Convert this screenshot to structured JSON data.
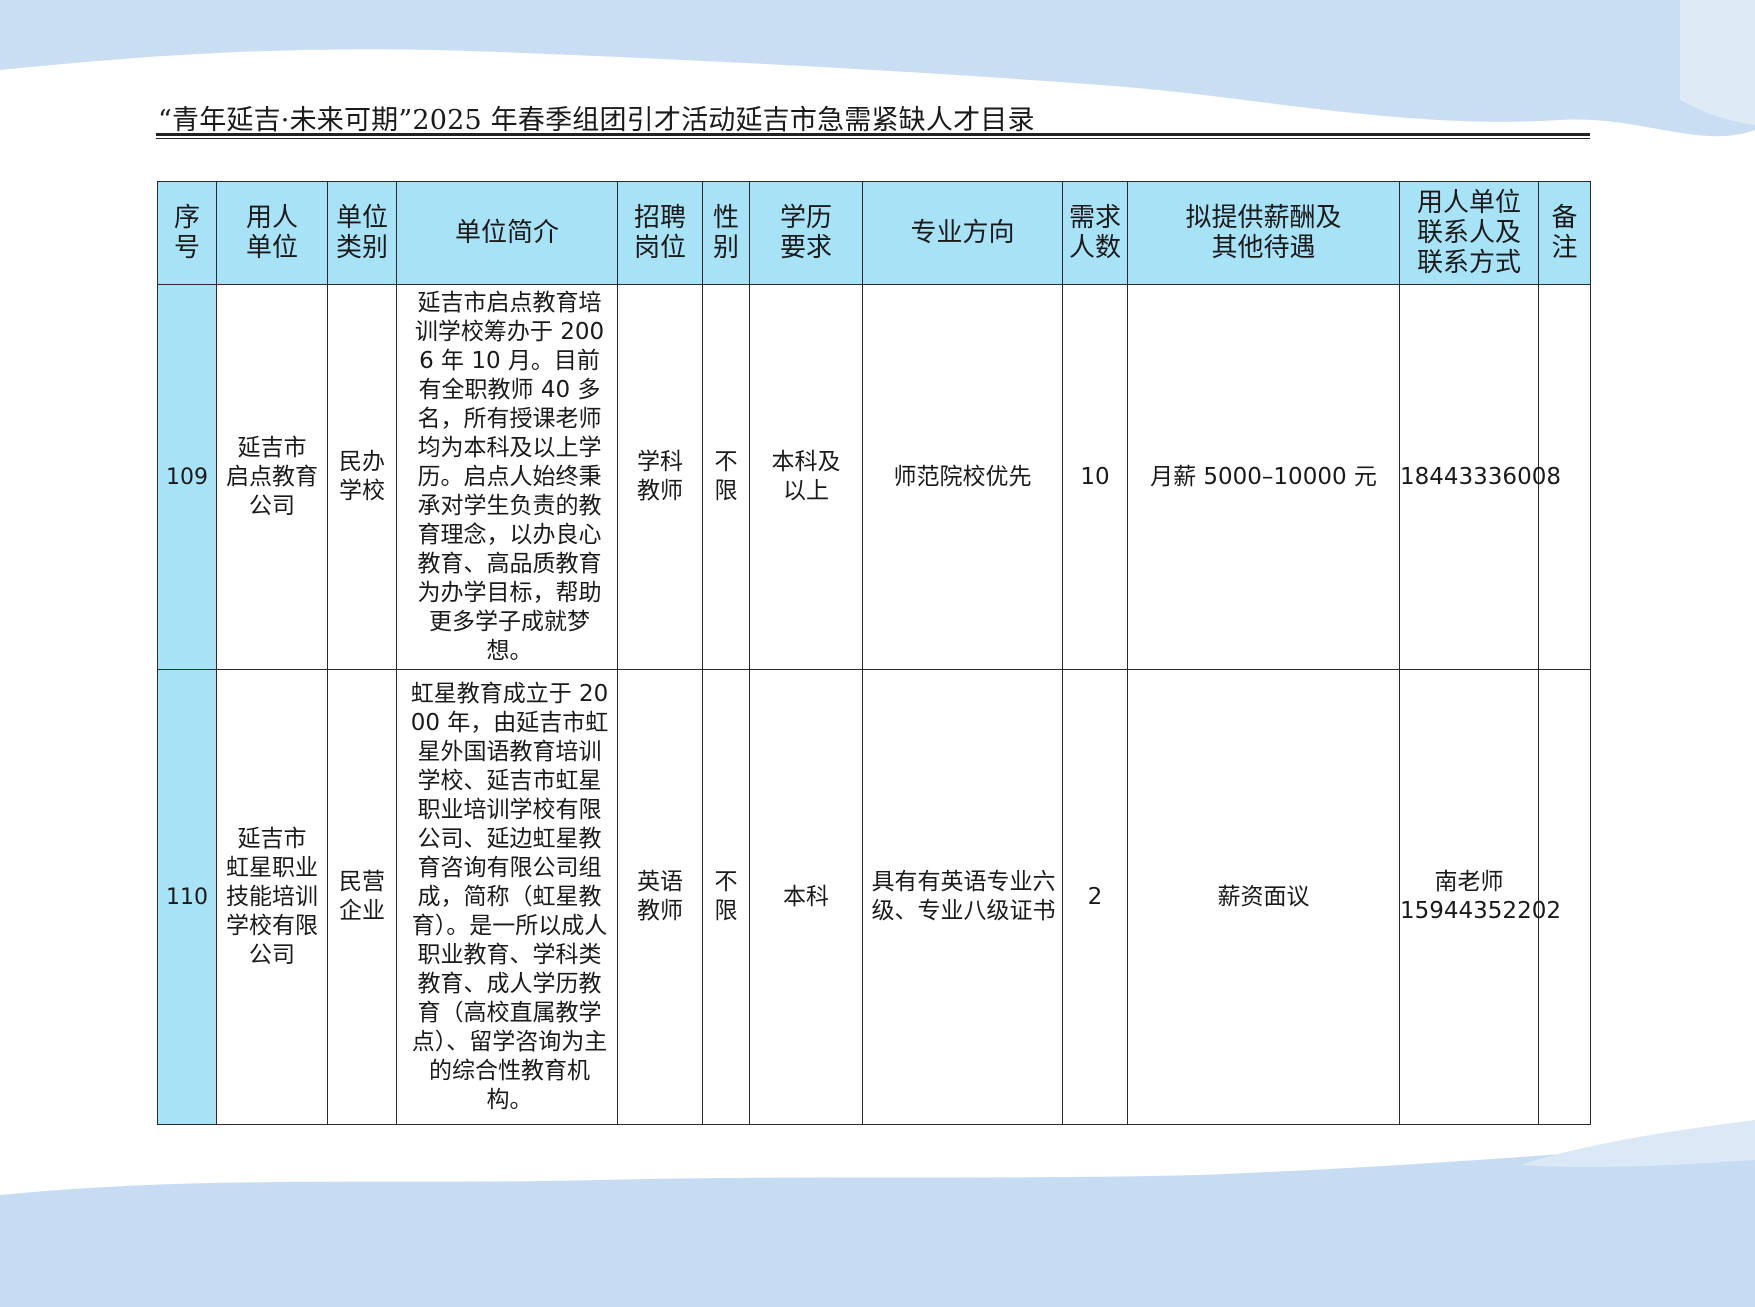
{
  "title": "“青年延吉·未来可期”2025 年春季组团引才活动延吉市急需紧缺人才目录",
  "columns": [
    [
      "序",
      "号"
    ],
    [
      "用人",
      "单位"
    ],
    [
      "单位",
      "类别"
    ],
    [
      "单位简介"
    ],
    [
      "招聘",
      "岗位"
    ],
    [
      "性",
      "别"
    ],
    [
      "学历",
      "要求"
    ],
    [
      "专业方向"
    ],
    [
      "需求",
      "人数"
    ],
    [
      "拟提供薪酬及",
      "其他待遇"
    ],
    [
      "用人单位",
      "联系人及",
      "联系方式"
    ],
    [
      "备",
      "注"
    ]
  ],
  "rows": [
    {
      "index": "109",
      "employer": [
        "延吉市",
        "启点教育",
        "公司"
      ],
      "type": [
        "民办",
        "学校"
      ],
      "intro": "延吉市启点教育培训学校筹办于 2006 年 10 月。目前有全职教师 40 多名，所有授课老师均为本科及以上学历。启点人始终秉承对学生负责的教育理念，以办良心教育、高品质教育为办学目标，帮助更多学子成就梦想。",
      "position": [
        "学科",
        "教师"
      ],
      "gender": [
        "不",
        "限"
      ],
      "education": [
        "本科及",
        "以上"
      ],
      "major": "师范院校优先",
      "headcount": "10",
      "salary": "月薪 5000–10000 元",
      "contact": [
        "18443336008"
      ],
      "remark": ""
    },
    {
      "index": "110",
      "employer": [
        "延吉市",
        "虹星职业",
        "技能培训",
        "学校有限",
        "公司"
      ],
      "type": [
        "民营",
        "企业"
      ],
      "intro": "虹星教育成立于 2000 年，由延吉市虹星外国语教育培训学校、延吉市虹星职业培训学校有限公司、延边虹星教育咨询有限公司组成，简称（虹星教育）。是一所以成人职业教育、学科类教育、成人学历教育（高校直属教学点）、留学咨询为主的综合性教育机构。",
      "position": [
        "英语",
        "教师"
      ],
      "gender": [
        "不",
        "限"
      ],
      "education": [
        "本科"
      ],
      "major": "具有有英语专业六级、专业八级证书",
      "headcount": "2",
      "salary": "薪资面议",
      "contact": [
        "南老师",
        "15944352202"
      ],
      "remark": ""
    }
  ],
  "colors": {
    "header_bg": "#a8e2f6",
    "wave_light": "#dbe8f6",
    "wave_mid": "#c6dcf2"
  }
}
